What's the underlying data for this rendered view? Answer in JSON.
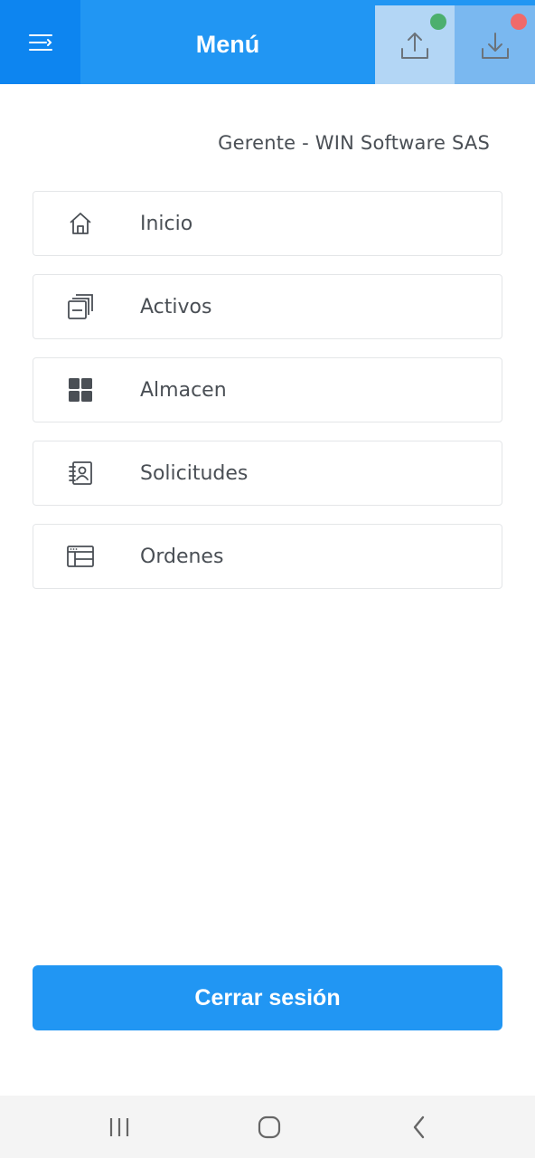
{
  "header": {
    "title": "Menú",
    "menu_icon": "menu-collapse-icon",
    "upload_icon": "upload-icon",
    "download_icon": "download-icon",
    "upload_status_color": "#4caf6e",
    "download_status_color": "#f06a6a"
  },
  "user": {
    "label": "Gerente - WIN Software SAS"
  },
  "menu": {
    "items": [
      {
        "label": "Inicio",
        "icon": "home-icon"
      },
      {
        "label": "Activos",
        "icon": "stack-icon"
      },
      {
        "label": "Almacen",
        "icon": "grid-icon"
      },
      {
        "label": "Solicitudes",
        "icon": "contact-book-icon"
      },
      {
        "label": "Ordenes",
        "icon": "window-list-icon"
      }
    ]
  },
  "logout": {
    "label": "Cerrar sesión"
  },
  "navbar": {
    "recents_icon": "recents-icon",
    "home_icon": "home-circle-icon",
    "back_icon": "back-icon"
  },
  "colors": {
    "primary": "#2196f3",
    "header_dark": "#0d85f0",
    "text": "#4a4f55"
  }
}
